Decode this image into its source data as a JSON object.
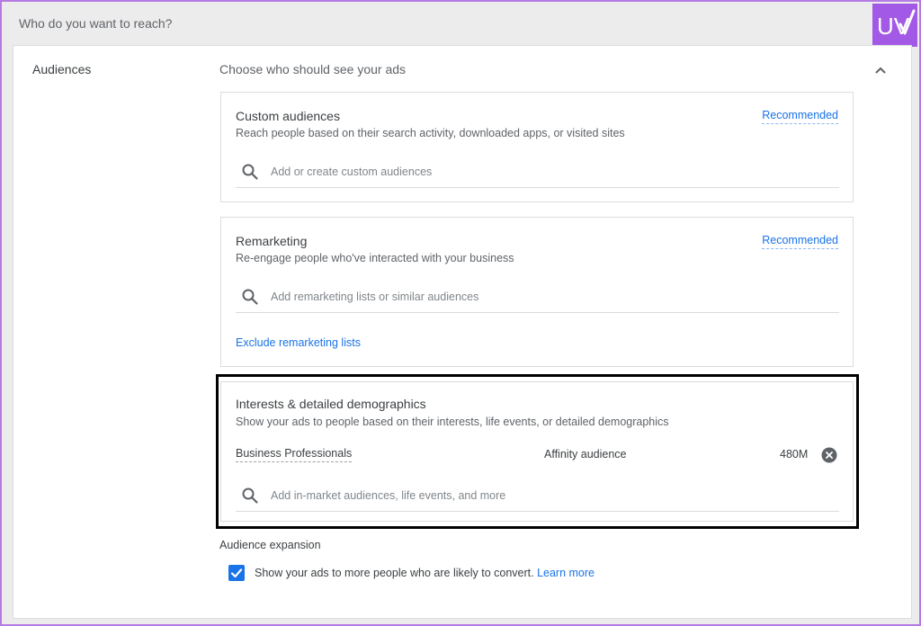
{
  "header": {
    "title": "Who do you want to reach?",
    "logo_text": "UV"
  },
  "section": {
    "label": "Audiences",
    "subtitle": "Choose who should see your ads"
  },
  "custom_audiences": {
    "title": "Custom audiences",
    "description": "Reach people based on their search activity, downloaded apps, or visited sites",
    "badge": "Recommended",
    "search_placeholder": "Add or create custom audiences"
  },
  "remarketing": {
    "title": "Remarketing",
    "description": "Re-engage people who've interacted with your business",
    "badge": "Recommended",
    "search_placeholder": "Add remarketing lists or similar audiences",
    "exclude_link": "Exclude remarketing lists"
  },
  "interests": {
    "title": "Interests & detailed demographics",
    "description": "Show your ads to people based on their interests, life events, or detailed demographics",
    "selected": [
      {
        "name": "Business Professionals",
        "type": "Affinity audience",
        "size": "480M"
      }
    ],
    "search_placeholder": "Add in-market audiences, life events, and more"
  },
  "expansion": {
    "label": "Audience expansion",
    "checkbox_checked": true,
    "checkbox_text": "Show your ads to more people who are likely to convert.",
    "learn_more": "Learn more"
  },
  "colors": {
    "accent": "#1a73e8",
    "logo_bg": "#a259e6",
    "frame_border": "#b57be3",
    "highlight_border": "#000000"
  },
  "icons": {
    "search": "search-icon",
    "collapse": "chevron-up-icon",
    "remove": "remove-circle-icon",
    "check": "check-icon"
  }
}
